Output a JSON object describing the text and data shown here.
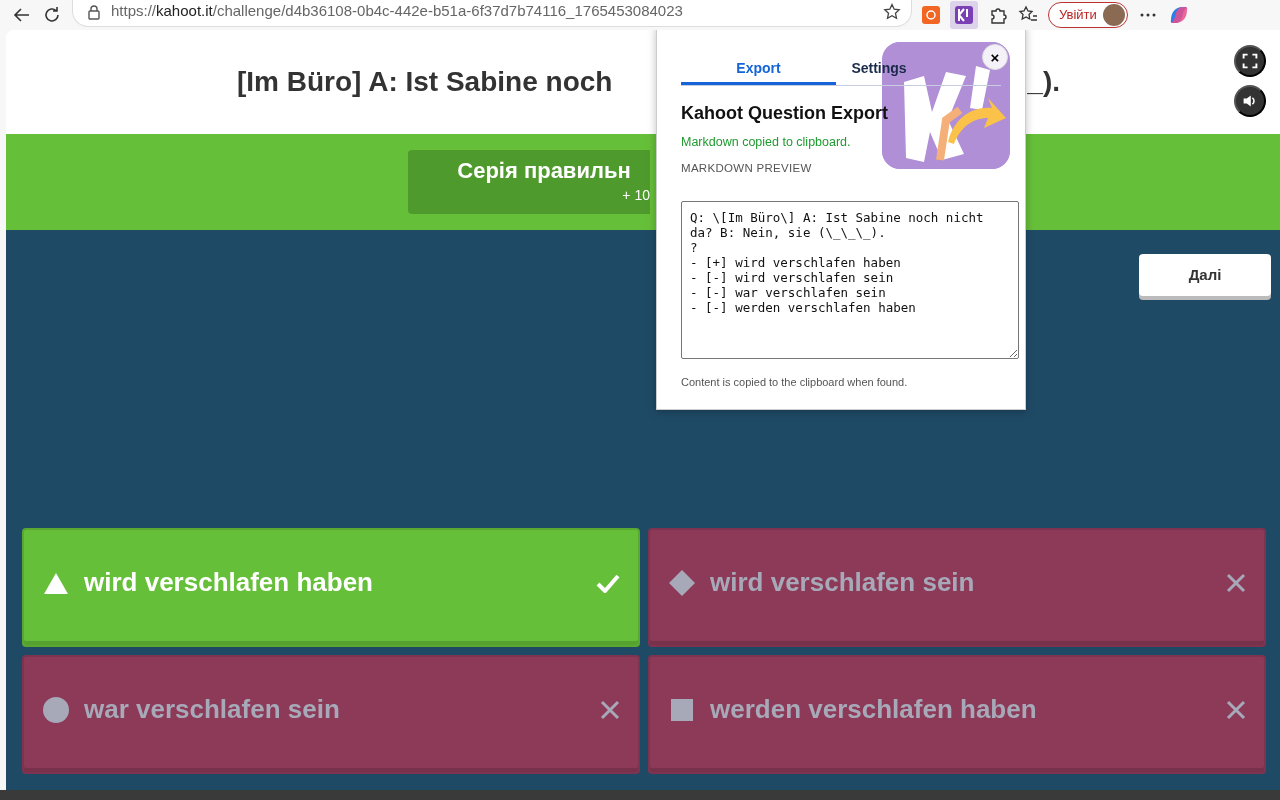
{
  "browser": {
    "url_scheme": "https://",
    "url_host": "kahoot.it",
    "url_path": "/challenge/d4b36108-0b4c-442e-b51a-6f37d7b74116_1765453084023",
    "sign_in": "Увійти"
  },
  "question": {
    "visible_parts": [
      "[Im Büro] A: Ist Sabine noch",
      "_)."
    ]
  },
  "streak": {
    "title": "Серія правильн",
    "points": "+ 10"
  },
  "next_button": "Далі",
  "answers": [
    {
      "kind": "triangle",
      "text": "wird verschlafen haben",
      "correct": true
    },
    {
      "kind": "diamond",
      "text": "wird verschlafen sein",
      "correct": false
    },
    {
      "kind": "circle",
      "text": "war verschlafen sein",
      "correct": false
    },
    {
      "kind": "square",
      "text": "werden verschlafen haben",
      "correct": false
    }
  ],
  "popup": {
    "tabs": [
      {
        "label": "Export",
        "selected": true
      },
      {
        "label": "Settings",
        "selected": false
      }
    ],
    "close": "×",
    "title": "Kahoot Question Export",
    "status": "Markdown copied to clipboard.",
    "preview_label": "MARKDOWN PREVIEW",
    "preview_text": "Q: \\[Im Büro\\] A: Ist Sabine noch nicht da? B: Nein, sie (\\_\\_\\_).\n?\n- [+] wird verschlafen haben\n- [-] wird verschlafen sein\n- [-] war verschlafen sein\n- [-] werden verschlafen haben",
    "footnote": "Content is copied to the clipboard when found."
  }
}
